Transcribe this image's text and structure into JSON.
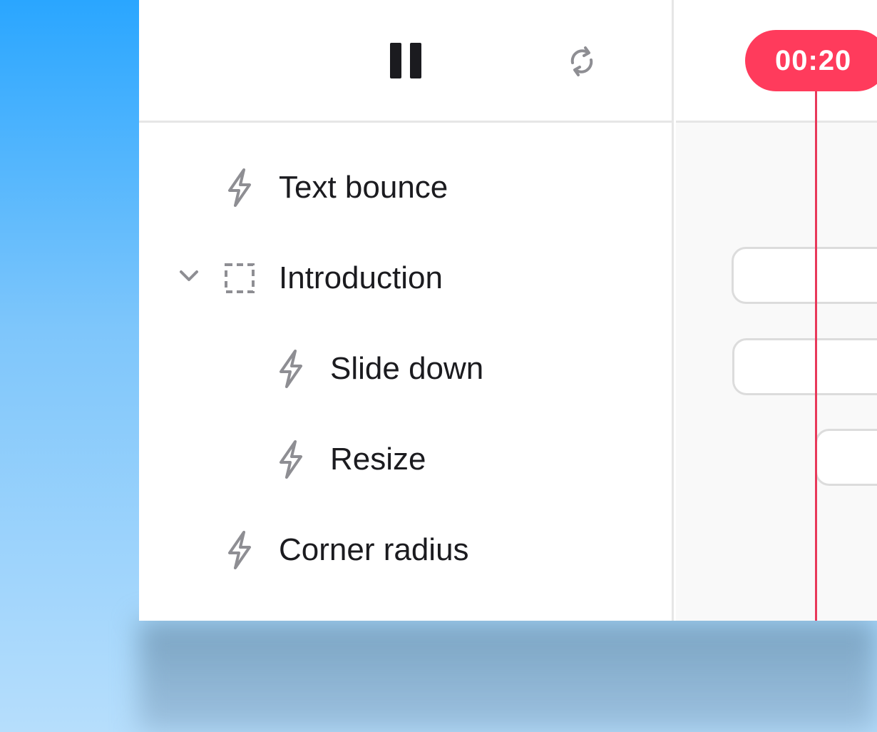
{
  "toolbar": {
    "pause_icon": "pause-icon",
    "loop_icon": "loop-icon"
  },
  "layers": [
    {
      "label": "Text bounce",
      "icon": "lightning-icon",
      "indent": 0
    },
    {
      "label": "Introduction",
      "icon": "dashed-frame-icon",
      "indent": 0,
      "expanded": true
    },
    {
      "label": "Slide down",
      "icon": "lightning-icon",
      "indent": 1
    },
    {
      "label": "Resize",
      "icon": "lightning-icon",
      "indent": 1
    },
    {
      "label": "Corner radius",
      "icon": "lightning-icon",
      "indent": 0
    }
  ],
  "timeline": {
    "playhead_time": "00:20"
  },
  "colors": {
    "accent": "#ff3b5c",
    "playhead_line": "#e8395a",
    "text": "#1b1b1f",
    "icon_gray": "#8e8e93",
    "divider": "#e6e6e6"
  }
}
